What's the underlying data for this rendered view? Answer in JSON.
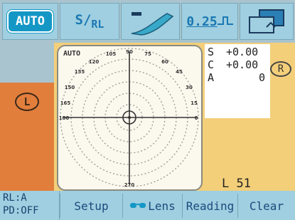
{
  "toolbar": {
    "auto_label": "AUTO",
    "sr_main": "S/",
    "sr_sub": "RL",
    "step_value": "0.25"
  },
  "left": {
    "lens_side": "L"
  },
  "target": {
    "auto_label": "AUTO",
    "angle_labels": [
      "90",
      "75",
      "60",
      "45",
      "30",
      "15",
      "0",
      "105",
      "120",
      "135",
      "150",
      "165",
      "180",
      "270"
    ]
  },
  "readings": {
    "s_label": "S",
    "s_value": "+0.00",
    "c_label": "C",
    "c_value": "+0.00",
    "a_label": "A",
    "a_value": "0",
    "side_badge": "R",
    "l_indicator": "L 51"
  },
  "bottom": {
    "rl_line1": "RL:A",
    "rl_line2": "PD:OFF",
    "setup_label": "Setup",
    "lens_label": "Lens",
    "reading_label": "Reading",
    "clear_label": "Clear"
  },
  "colors": {
    "accent": "#1597c6",
    "toolbar_bg": "#9fcfe0",
    "lens_panel": "#e27e3c",
    "reading_panel": "#f3cf7a"
  }
}
